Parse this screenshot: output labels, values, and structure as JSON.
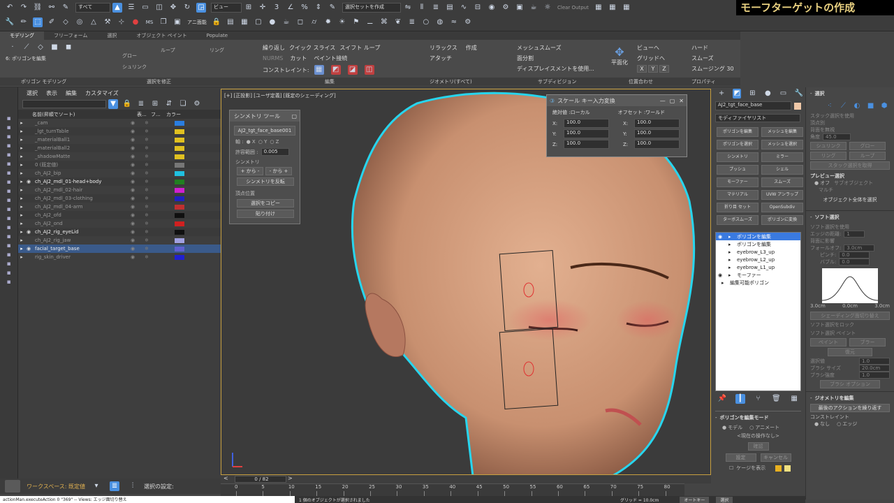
{
  "toolbar": {
    "select_filter": "すべて",
    "view_dropdown": "ビュー",
    "selection_set": "選択セットを作成",
    "clear_output": "Clear Output",
    "anim_ui": "アニ面能",
    "title_overlay": "モーフターゲットの作成"
  },
  "ribbon_tabs": [
    "モデリング",
    "フリーフォーム",
    "選択",
    "オブジェクト ペイント",
    "Populate"
  ],
  "ribbon": {
    "poly_edit_label": "6: ポリゴンを編集",
    "grow": "グロー",
    "shrink": "シュリンク",
    "loop": "ループ",
    "ring": "リング",
    "repeat_last": "繰り返し",
    "quick_slice": "クイック スライス",
    "swift_loop": "スイフト ループ",
    "nurms": "NURMS",
    "cut": "カット",
    "paint_connect": "ペイント接続",
    "constraint": "コンストレイント:",
    "relax": "リラックス",
    "create": "作成",
    "attach": "アタッチ",
    "mesh_smooth": "メッシュスムーズ",
    "tessellate": "面分割",
    "displace": "ディスプレイスメントを使用...",
    "to_view": "ビューへ",
    "to_grid": "グリッドへ",
    "xyz": [
      "X",
      "Y",
      "Z"
    ],
    "flat": "平面化",
    "hard": "ハード",
    "smooth": "スムーズ",
    "smooth30": "スムージング 30",
    "groups": [
      "ポリゴン モデリング",
      "選択を修正",
      "編集",
      "ジオメトリ(すべて)",
      "サブディビジョン",
      "位置合わせ",
      "プロパティ"
    ]
  },
  "scene_explorer": {
    "menu": [
      "選択",
      "表示",
      "編集",
      "カスタマイズ"
    ],
    "headers": {
      "name": "名前(昇順でソート)",
      "display": "表...",
      "freeze": "フ...",
      "color": "カラー"
    },
    "rows": [
      {
        "name": "_cam",
        "color": "#2a7de0",
        "vis": false
      },
      {
        "name": "_lgt_turnTable",
        "color": "#e0c020",
        "vis": false
      },
      {
        "name": "_materialBall1",
        "color": "#e0c020",
        "vis": false
      },
      {
        "name": "_materialBall2",
        "color": "#e0c020",
        "vis": false
      },
      {
        "name": "_shadowMatte",
        "color": "#e0c020",
        "vis": false
      },
      {
        "name": "0 (既定値)",
        "color": "#777777",
        "vis": false
      },
      {
        "name": "ch_AJ2_bip",
        "color": "#20c0e0",
        "vis": false
      },
      {
        "name": "ch_AJ2_mdl_01-head+body",
        "color": "#208020",
        "vis": true
      },
      {
        "name": "ch_AJ2_mdl_02-hair",
        "color": "#d020d0",
        "vis": false
      },
      {
        "name": "ch_AJ2_mdl_03-clothing",
        "color": "#2020c0",
        "vis": false
      },
      {
        "name": "ch_AJ2_mdl_04-arm",
        "color": "#c03030",
        "vis": false
      },
      {
        "name": "ch_AJ2_ofd",
        "color": "#101010",
        "vis": false
      },
      {
        "name": "ch_AJ2_ond",
        "color": "#d02020",
        "vis": false
      },
      {
        "name": "ch_AJ2_rig_eyeLid",
        "color": "#101010",
        "vis": true
      },
      {
        "name": "ch_AJ2_rig_jaw",
        "color": "#a0a0e0",
        "vis": false
      },
      {
        "name": "facial_target_base",
        "color": "#6060d0",
        "vis": true
      },
      {
        "name": "rig_skin_driver",
        "color": "#2020d0",
        "vis": false
      }
    ]
  },
  "symmetry_tool": {
    "title": "シンメトリ ツール",
    "object": "AJ2_tgt_face_base001",
    "axis_label": "軸 :",
    "axes": [
      "X",
      "Y",
      "Z"
    ],
    "tolerance_label": "許容範囲 :",
    "tolerance": "0.005",
    "symmetry_section": "シンメトリ",
    "plus_to_minus": "+ から -",
    "minus_to_plus": "- から +",
    "flip": "シンメトリを反転",
    "vertex_section": "頂点位置",
    "copy": "選択をコピー",
    "paste": "貼り付け"
  },
  "scale_dialog": {
    "title": "スケール キー入力変換",
    "absolute": "絶対値 :ローカル",
    "offset": "オフセット :ワールド",
    "abs_values": [
      {
        "axis": "X:",
        "value": "100.0"
      },
      {
        "axis": "Y:",
        "value": "100.0"
      },
      {
        "axis": "Z:",
        "value": "100.0"
      }
    ],
    "off_values": [
      {
        "axis": "X:",
        "value": "100.0"
      },
      {
        "axis": "Y:",
        "value": "100.0"
      },
      {
        "axis": "Z:",
        "value": "100.0"
      }
    ]
  },
  "viewport": {
    "label": "[+] [正投影] [ユーザ定義] [既定のシェーディング]"
  },
  "modify_panel": {
    "object_name": "AJ2_tgt_face_base",
    "modifier_list": "モディファイヤリスト",
    "buttons": [
      "ポリゴンを編集",
      "メッシュを編集",
      "ポリゴンを選択",
      "メッシュを選択",
      "シンメトリ",
      "ミラー",
      "プッシュ",
      "シェル",
      "モーファー",
      "スムーズ",
      "マテリアル",
      "UVW アンラップ",
      "折り目 セット",
      "OpenSubdiv",
      "ターボスムーズ",
      "ポリゴンに変換"
    ],
    "stack": [
      {
        "name": "ポリゴンを編集",
        "selected": true,
        "eye": true
      },
      {
        "name": "ポリゴンを編集",
        "selected": false,
        "eye": false
      },
      {
        "name": "eyebrow_L3_up",
        "selected": false,
        "eye": false
      },
      {
        "name": "eyebrow_L2_up",
        "selected": false,
        "eye": false
      },
      {
        "name": "eyebrow_L1_up",
        "selected": false,
        "eye": false
      },
      {
        "name": "モーファー",
        "selected": false,
        "eye": true
      },
      {
        "name": "編集可能ポリゴン",
        "selected": false,
        "eye": false
      }
    ],
    "edit_mode_title": "ポリゴンを編集モード",
    "model": "モデル",
    "animate": "アニメート",
    "current_op": "<現在の操作なし>",
    "commit": "確認",
    "settings": "設定",
    "cancel": "キャンセル",
    "show_cage": "ケージを表示"
  },
  "props_panel": {
    "selection_title": "選択",
    "use_stack": "スタック選択を使用",
    "by_vertex": "頂点別",
    "ignore_back": "背面を無視",
    "by_angle": "角度",
    "angle_value": "45.0",
    "shrink": "シュリンク",
    "grow": "グロー",
    "ring": "リング",
    "loop": "ループ",
    "get_stack": "スタック選択を取得",
    "preview_title": "プレビュー選択",
    "off": "オフ",
    "subobj": "サブオブジェクト",
    "multi": "マルチ",
    "whole_obj": "オブジェクト全体を選択",
    "soft_title": "ソフト選択",
    "use_soft": "ソフト選択を使用",
    "edge_dist": "エッジの距離:",
    "edge_dist_value": "1",
    "affect_back": "背面に影響",
    "falloff": "フォールオフ:",
    "falloff_value": "3.0cm",
    "pinch": "ピンチ:",
    "pinch_value": "0.0",
    "bubble": "バブル:",
    "bubble_value": "0.0",
    "curve_labels": [
      "3.0cm",
      "0.0cm",
      "3.0cm"
    ],
    "shaded_face": "シェーディング面切り替え",
    "lock_soft": "ソフト選択をロック",
    "paint_soft": "ソフト選択 ペイント",
    "paint": "ペイント",
    "blur": "ブラー",
    "revert": "復元",
    "sel_value": "選択値",
    "sel_value_v": "1.0",
    "brush_size": "ブラシ サイズ",
    "brush_size_v": "20.0cm",
    "brush_strength": "ブラシ強度",
    "brush_strength_v": "1.0",
    "brush_options": "ブラシ オプション",
    "geo_title": "ジオメトリを編集",
    "repeat_last": "最後のアクションを繰り返す",
    "constraint": "コンストレイント",
    "none": "なし",
    "edge": "エッジ"
  },
  "timeline": {
    "frame": "0 / 82",
    "ticks": [
      "0",
      "5",
      "10",
      "15",
      "20",
      "25",
      "30",
      "35",
      "40",
      "45",
      "50",
      "55",
      "60",
      "65",
      "70",
      "75",
      "80"
    ]
  },
  "status": {
    "workspace": "ワークスペース: 既定値",
    "select_settings": "選択の設定:",
    "maxscript": "actionMan.executeAction 0 \"369\" -- Views: エッジ面切り替え",
    "prompt": "1 個のオブジェクトが選択されました",
    "auto_key": "オートキー",
    "selected": "選択",
    "grid": "グリッド = 10.0cm"
  },
  "colors": {
    "accent": "#4a90e0",
    "selection_outline": "#27d5ee",
    "panel_bg": "#444444",
    "viewport_bg": "#3b3b3b"
  }
}
